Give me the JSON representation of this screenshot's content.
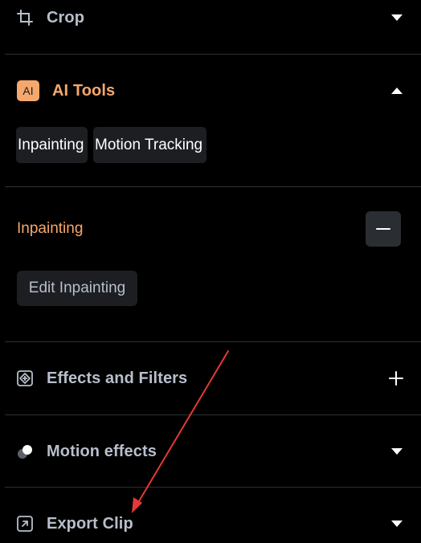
{
  "sections": {
    "crop": {
      "title": "Crop",
      "icon": "crop-icon",
      "state": "collapsed"
    },
    "ai_tools": {
      "badge": "AI",
      "title": "AI Tools",
      "icon": "ai-badge-icon",
      "state": "expanded",
      "tabs": [
        "Inpainting",
        "Motion Tracking"
      ],
      "active_tool": {
        "title": "Inpainting",
        "action_label": "Edit Inpainting"
      }
    },
    "effects": {
      "title": "Effects and Filters",
      "icon": "effects-icon",
      "state": "collapsed"
    },
    "motion": {
      "title": "Motion effects",
      "icon": "motion-effects-icon",
      "state": "collapsed"
    },
    "export": {
      "title": "Export Clip",
      "icon": "export-icon",
      "state": "collapsed"
    }
  },
  "colors": {
    "background": "#000000",
    "accent": "#f5a86d",
    "muted_text": "#b7bfcb",
    "chip_bg": "#1c1e22",
    "divider": "#2c2f33",
    "annotation_arrow": "#e53935"
  }
}
